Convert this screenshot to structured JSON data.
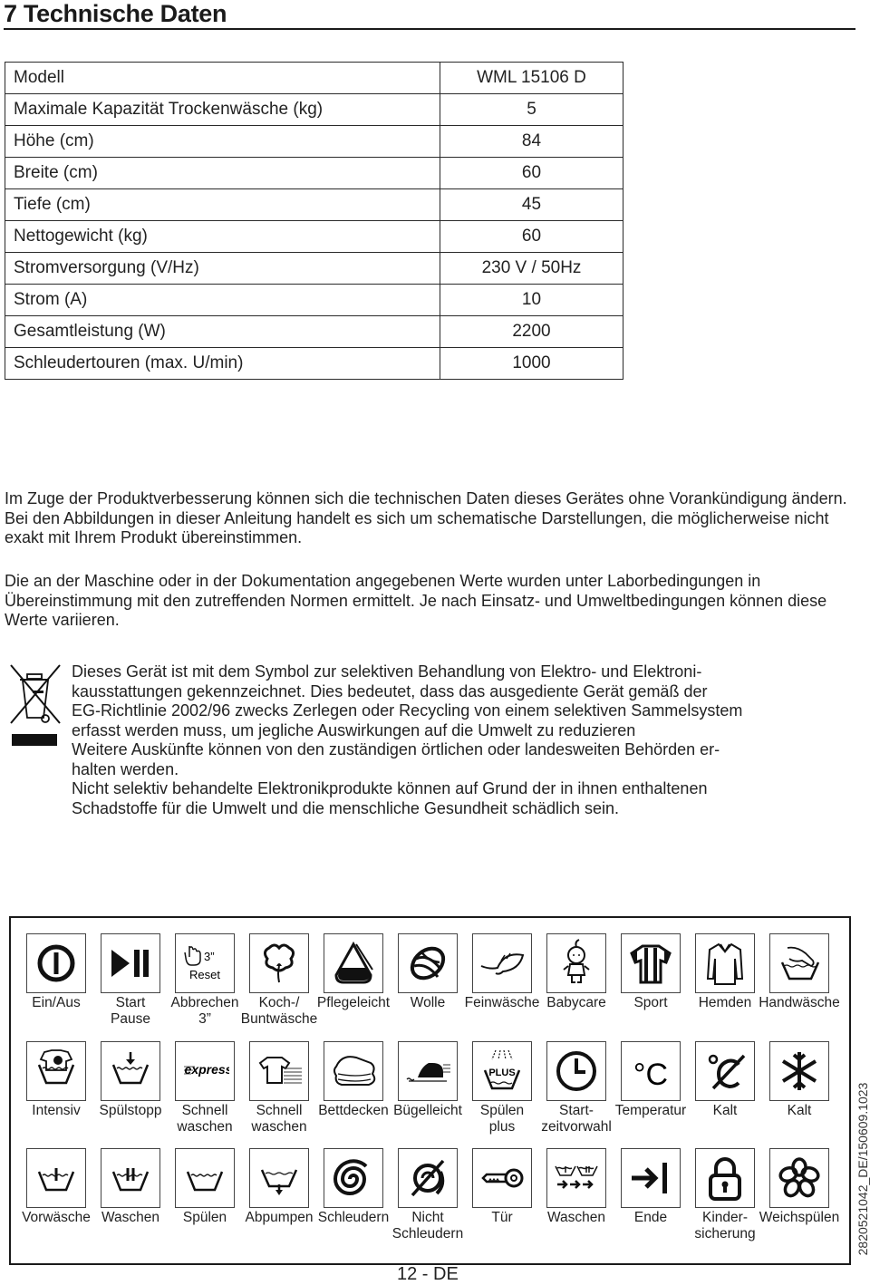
{
  "title": "7 Technische Daten",
  "spec_table": [
    {
      "key": "Modell",
      "value": "WML 15106 D"
    },
    {
      "key": "Maximale Kapazität Trockenwäsche (kg)",
      "value": "5"
    },
    {
      "key": "Höhe (cm)",
      "value": "84"
    },
    {
      "key": "Breite (cm)",
      "value": "60"
    },
    {
      "key": "Tiefe (cm)",
      "value": "45"
    },
    {
      "key": "Nettogewicht (kg)",
      "value": "60"
    },
    {
      "key": "Stromversorgung (V/Hz)",
      "value": "230 V / 50Hz"
    },
    {
      "key": "Strom (A)",
      "value": "10"
    },
    {
      "key": "Gesamtleistung (W)",
      "value": "2200"
    },
    {
      "key": "Schleudertouren (max. U/min)",
      "value": "1000"
    }
  ],
  "paragraphs": [
    "Im Zuge der Produktverbesserung können sich die technischen Daten dieses Gerätes ohne Vorankündigung ändern. Bei den Abbildungen in dieser Anleitung handelt es sich um schematische Darstellungen, die möglicherweise nicht exakt mit Ihrem Produkt übereinstimmen.",
    "Die an der Maschine oder in der Dokumentation angegebenen Werte wurden unter Laborbedingungen in Übereinstimmung mit den zutreffenden Normen ermittelt.  Je nach Einsatz- und Umweltbedingungen können diese Werte variieren."
  ],
  "weee": {
    "icon": "crossed-out-wheelie-bin-icon",
    "lines": [
      "Dieses Gerät ist mit dem Symbol zur selektiven Behandlung von Elektro- und Elektroni-",
      "kausstattungen gekennzeichnet. Dies bedeutet, dass das ausgediente Gerät gemäß der",
      "EG-Richtlinie 2002/96 zwecks Zerlegen oder Recycling von einem selektiven Sammelsystem",
      "erfasst werden muss, um jegliche Auswirkungen auf die Umwelt zu reduzieren",
      "Weitere Auskünfte können von den zuständigen örtlichen oder landesweiten Behörden er-",
      "halten werden.",
      "Nicht selektiv behandelte Elektronikprodukte können auf Grund der in ihnen enthaltenen",
      "Schadstoffe für die Umwelt und die menschliche Gesundheit schädlich sein."
    ]
  },
  "legend": {
    "rows": [
      [
        {
          "icon": "power-icon",
          "label": [
            "Ein/Aus"
          ]
        },
        {
          "icon": "play-pause-icon",
          "label": [
            "Start",
            "Pause"
          ]
        },
        {
          "icon": "hand-reset-icon",
          "icon_text": [
            "3”",
            "Reset"
          ],
          "label": [
            "Abbrechen",
            "3”"
          ]
        },
        {
          "icon": "cotton-icon",
          "label": [
            "Koch-/",
            "Buntwäsche"
          ]
        },
        {
          "icon": "synthetic-icon",
          "label": [
            "Pflegeleicht"
          ]
        },
        {
          "icon": "wool-icon",
          "label": [
            "Wolle"
          ]
        },
        {
          "icon": "feather-icon",
          "label": [
            "Feinwäsche"
          ]
        },
        {
          "icon": "baby-icon",
          "label": [
            "Babycare"
          ]
        },
        {
          "icon": "sport-shirt-icon",
          "label": [
            "Sport"
          ]
        },
        {
          "icon": "shirt-icon",
          "label": [
            "Hemden"
          ]
        },
        {
          "icon": "hand-wash-icon",
          "label": [
            "Handwäsche"
          ]
        }
      ],
      [
        {
          "icon": "intensive-icon",
          "label": [
            "Intensiv"
          ]
        },
        {
          "icon": "rinse-hold-icon",
          "label": [
            "Spülstopp"
          ]
        },
        {
          "icon": "express-icon",
          "icon_text": [
            "express"
          ],
          "label": [
            "Schnell",
            "waschen"
          ]
        },
        {
          "icon": "quick-wash-shirt-icon",
          "label": [
            "Schnell",
            "waschen"
          ]
        },
        {
          "icon": "duvet-icon",
          "label": [
            "Bettdecken"
          ]
        },
        {
          "icon": "iron-icon",
          "label": [
            "Bügelleicht"
          ]
        },
        {
          "icon": "rinse-plus-icon",
          "icon_text": [
            "PLUS"
          ],
          "label": [
            "Spülen",
            "plus"
          ]
        },
        {
          "icon": "clock-icon",
          "label": [
            "Start-",
            "zeitvorwahl"
          ]
        },
        {
          "icon": "temperature-icon",
          "icon_text": [
            "°C"
          ],
          "label": [
            "Temperatur"
          ]
        },
        {
          "icon": "cold-crossed-icon",
          "label": [
            "Kalt"
          ]
        },
        {
          "icon": "snowflake-icon",
          "label": [
            "Kalt"
          ]
        }
      ],
      [
        {
          "icon": "prewash-icon",
          "label": [
            "Vorwäsche"
          ]
        },
        {
          "icon": "main-wash-icon",
          "label": [
            "Waschen"
          ]
        },
        {
          "icon": "rinse-icon",
          "label": [
            "Spülen"
          ]
        },
        {
          "icon": "drain-icon",
          "label": [
            "Abpumpen"
          ]
        },
        {
          "icon": "spin-icon",
          "label": [
            "Schleudern"
          ]
        },
        {
          "icon": "no-spin-icon",
          "label": [
            "Nicht",
            "Schleudern"
          ]
        },
        {
          "icon": "key-icon",
          "label": [
            "Tür"
          ]
        },
        {
          "icon": "wash-sequence-icon",
          "label": [
            "Waschen"
          ]
        },
        {
          "icon": "end-icon",
          "label": [
            "Ende"
          ]
        },
        {
          "icon": "lock-icon",
          "label": [
            "Kinder-",
            "sicherung"
          ]
        },
        {
          "icon": "flower-icon",
          "label": [
            "Weichspülen"
          ]
        }
      ]
    ]
  },
  "page_number": "12 - DE",
  "document_code": "2820521042_DE/150609.1023"
}
